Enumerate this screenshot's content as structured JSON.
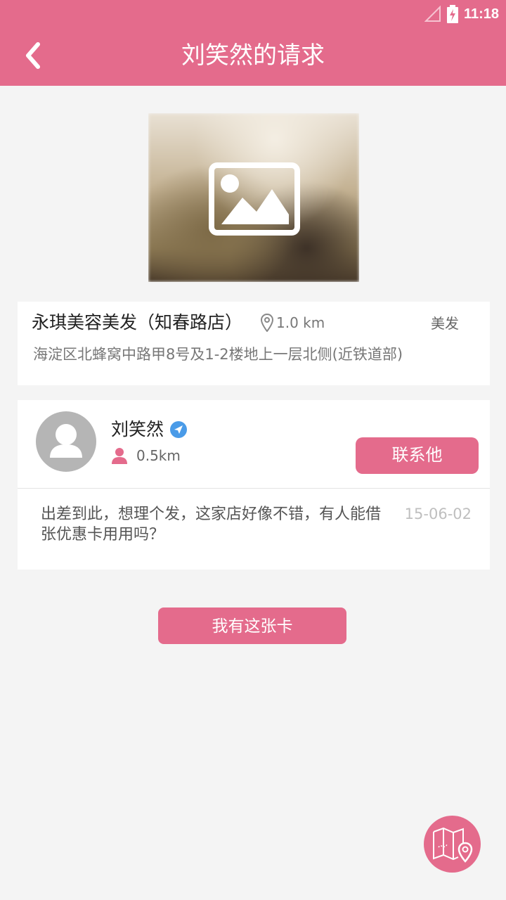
{
  "status_bar": {
    "time": "11:18",
    "icons": [
      "signal-icon",
      "battery-icon"
    ]
  },
  "header": {
    "title": "刘笑然的请求",
    "back_icon": "chevron-left-icon"
  },
  "shop": {
    "photo_icon": "image-placeholder-icon",
    "name": "永琪美容美发（知春路店）",
    "distance": "1.0 km",
    "category": "美发",
    "address": "海淀区北蜂窝中路甲8号及1-2楼地上一层北侧(近铁道部)"
  },
  "request": {
    "user_name": "刘笑然",
    "verified_icon": "verified-badge-icon",
    "distance": "0.5km",
    "contact_label": "联系他",
    "message": "出差到此，想理个发，这家店好像不错，有人能借张优惠卡用用吗？",
    "date": "15-06-02"
  },
  "actions": {
    "have_card_label": "我有这张卡",
    "map_icon": "map-pin-icon"
  },
  "colors": {
    "accent": "#e46b8c",
    "background": "#f4f4f4",
    "verified": "#4a9be8"
  }
}
